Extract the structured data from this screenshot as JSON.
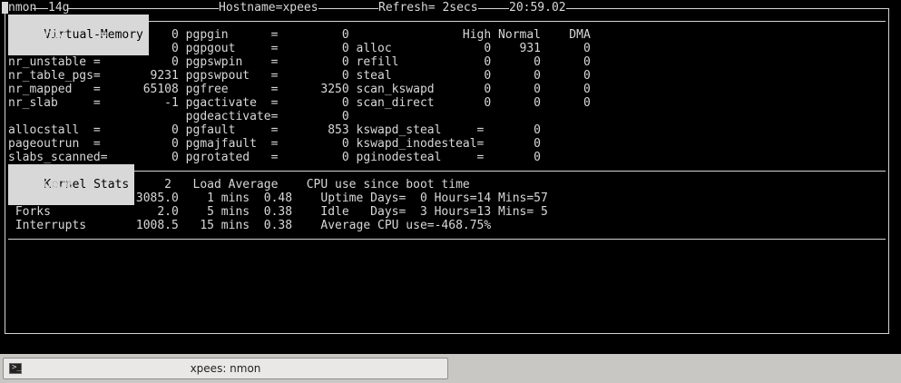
{
  "titlebar": {
    "program": "nmon",
    "version": "14g",
    "hostname": "Hostname=xpees",
    "refresh": "Refresh= 2secs",
    "clock": "20:59.02"
  },
  "virtual_memory": {
    "title": "Virtual-Memory",
    "lines": [
      "nr_dirty     =         0 pgpgin      =         0                High Normal    DMA",
      "nr_writeback=          0 pgpgout     =         0 alloc             0    931      0",
      "nr_unstable =          0 pgpswpin    =         0 refill            0      0      0",
      "nr_table_pgs=       9231 pgpswpout   =         0 steal             0      0      0",
      "nr_mapped   =      65108 pgfree      =      3250 scan_kswapd       0      0      0",
      "nr_slab     =         -1 pgactivate  =         0 scan_direct       0      0      0",
      "                         pgdeactivate=         0",
      "allocstall  =          0 pgfault     =       853 kswapd_steal     =       0",
      "pageoutrun  =          0 pgmajfault  =         0 kswapd_inodesteal=       0",
      "slabs_scanned=         0 pgrotated   =         0 pginodesteal     =       0"
    ]
  },
  "kernel_stats": {
    "title": "Kernel Stats",
    "lines": [
      " RunQueue             2   Load Average    CPU use since boot time",
      " ContextSwitch    3085.0    1 mins  0.48    Uptime Days=  0 Hours=14 Mins=57",
      " Forks               2.0    5 mins  0.38    Idle   Days=  3 Hours=13 Mins= 5",
      " Interrupts       1008.5   15 mins  0.38    Average CPU use=-468.75%"
    ]
  },
  "taskbar": {
    "window_label": "xpees: nmon",
    "icon": "terminal-icon"
  },
  "colors": {
    "terminal_bg": "#000000",
    "terminal_fg": "#d8d8d8",
    "highlight_bg": "#d8d8d8",
    "taskbar_bg": "#c9c7c3"
  }
}
